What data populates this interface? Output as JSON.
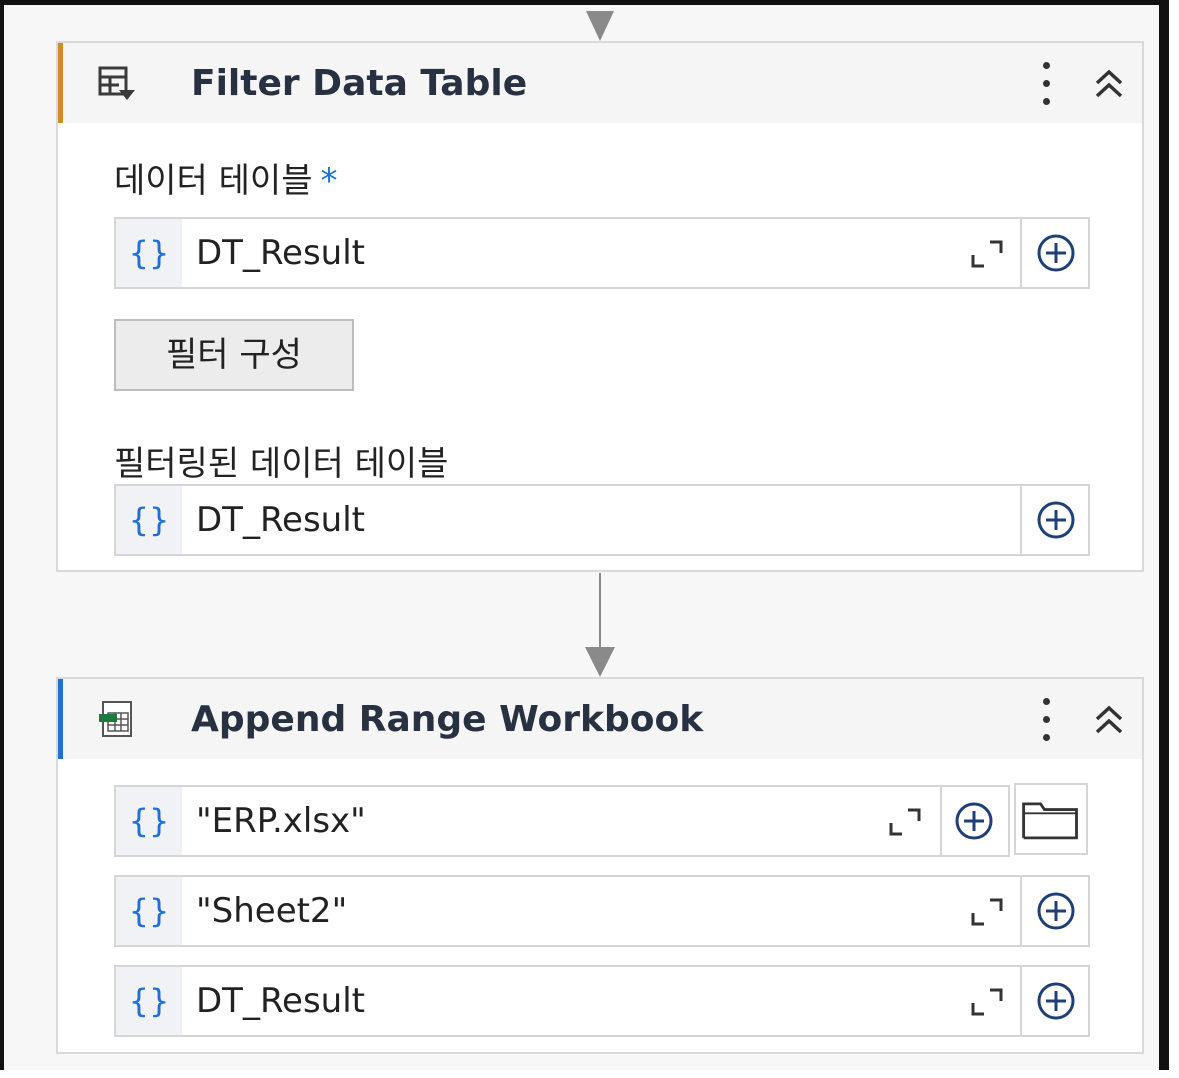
{
  "activities": [
    {
      "title": "Filter Data Table",
      "icon": "filter-table-icon",
      "accent": "#d28a22",
      "fields": {
        "datatable_label": "데이터 테이블",
        "required_marker": "*",
        "datatable_value": "DT_Result",
        "configure_button": "필터 구성",
        "output_label": "필터링된 데이터 테이블",
        "output_value": "DT_Result"
      }
    },
    {
      "title": "Append Range Workbook",
      "icon": "excel-workbook-icon",
      "accent": "#1f6fd6",
      "fields": {
        "workbook_value": "\"ERP.xlsx\"",
        "sheet_value": "\"Sheet2\"",
        "datatable_value": "DT_Result"
      }
    }
  ],
  "braces_symbol": "{}"
}
